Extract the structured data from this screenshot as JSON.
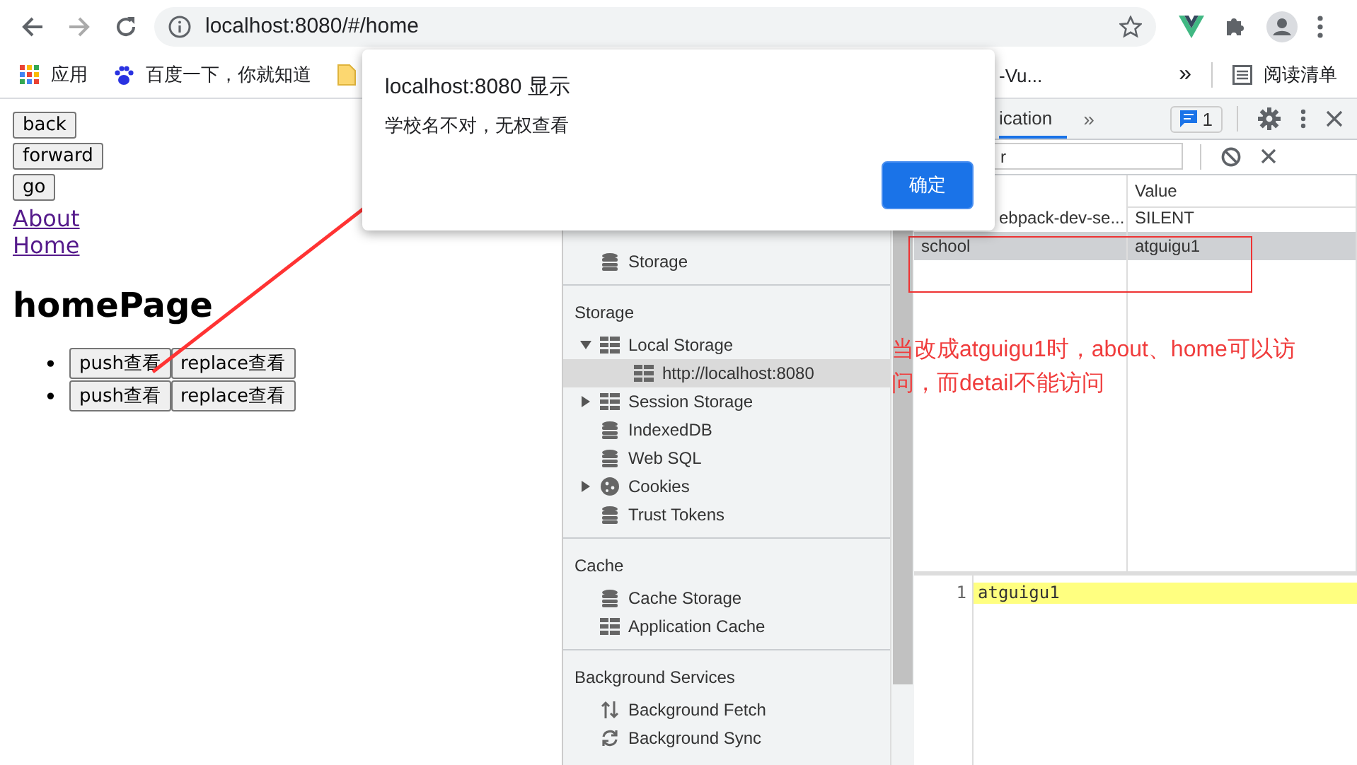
{
  "browser": {
    "address": "localhost:8080/#/home",
    "bookmarks": [
      {
        "kind": "apps",
        "label": "应用"
      },
      {
        "kind": "paw",
        "label": "百度一下，你就知道"
      },
      {
        "kind": "folder"
      },
      {
        "kind": "text",
        "label": "-Vu..."
      }
    ],
    "more": "»",
    "reading_list": "阅读清单"
  },
  "page": {
    "buttons": [
      "back",
      "forward",
      "go"
    ],
    "links": [
      "About",
      "Home"
    ],
    "heading": "homePage",
    "list": [
      {
        "marker": "•",
        "buttons": [
          "push查看",
          "replace查看"
        ]
      },
      {
        "marker": "•",
        "buttons": [
          "push查看",
          "replace查看"
        ]
      }
    ]
  },
  "devtools": {
    "tab": "ication",
    "more": "»",
    "message_count": "1",
    "filter_value": "r",
    "sidebar": [
      {
        "items": [
          {
            "kind": "db",
            "label": "Storage",
            "selected": false
          }
        ]
      },
      {
        "title": "Storage",
        "items": [
          {
            "kind": "grid",
            "label": "Local Storage",
            "selected": false,
            "expanded": true,
            "children": [
              {
                "kind": "grid",
                "label": "http://localhost:8080",
                "selected": true
              }
            ]
          },
          {
            "kind": "grid",
            "label": "Session Storage",
            "selected": false,
            "expanded": false
          },
          {
            "kind": "db",
            "label": "IndexedDB",
            "selected": false
          },
          {
            "kind": "db",
            "label": "Web SQL",
            "selected": false
          },
          {
            "kind": "cookie",
            "label": "Cookies",
            "selected": false,
            "expanded": false
          },
          {
            "kind": "db",
            "label": "Trust Tokens",
            "selected": false
          }
        ]
      },
      {
        "title": "Cache",
        "items": [
          {
            "kind": "db",
            "label": "Cache Storage",
            "selected": false
          },
          {
            "kind": "grid",
            "label": "Application Cache",
            "selected": false
          }
        ]
      },
      {
        "title": "Background Services",
        "items": [
          {
            "kind": "updown",
            "label": "Background Fetch",
            "selected": false
          },
          {
            "kind": "sync",
            "label": "Background Sync",
            "selected": false
          }
        ]
      }
    ],
    "table": {
      "value_header": "Value",
      "rows": [
        {
          "key": "ebpack-dev-se...",
          "value": "SILENT",
          "selected": false
        },
        {
          "key": "school",
          "value": "atguigu1",
          "selected": true
        }
      ]
    },
    "editor": {
      "line_number": "1",
      "text": "atguigu1"
    }
  },
  "dialog": {
    "title": "localhost:8080 显示",
    "message": "学校名不对，无权查看",
    "button": "确定"
  },
  "annotation": {
    "text": "当改成atguigu1时，about、home可以访问，而detail不能访问"
  }
}
